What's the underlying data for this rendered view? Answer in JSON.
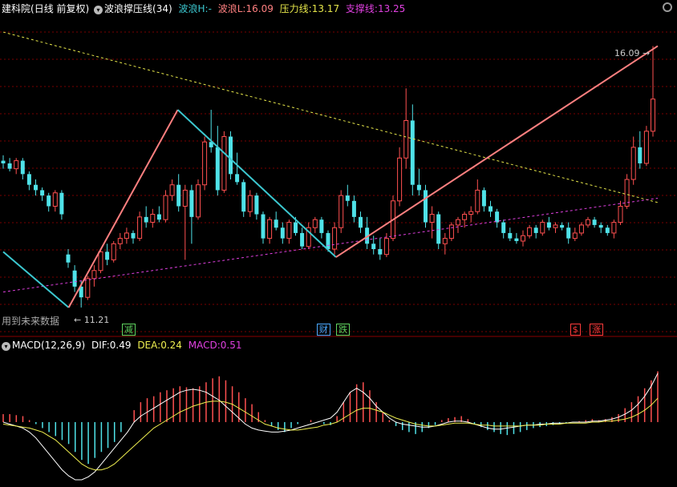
{
  "header": {
    "title": "建科院",
    "period": "(日线 前复权)",
    "indicator_name": "波浪撑压线(34)",
    "wave_h_label": "波浪H:",
    "wave_h_value": "-",
    "wave_l_label": "波浪L:",
    "wave_l_value": "16.09",
    "pressure_label": "压力线:",
    "pressure_value": "13.17",
    "support_label": "支撑线:",
    "support_value": "13.25"
  },
  "macd_header": {
    "name": "MACD(12,26,9)",
    "dif_label": "DIF:",
    "dif_value": "0.49",
    "dea_label": "DEA:",
    "dea_value": "0.24",
    "macd_label": "MACD:",
    "macd_value": "0.51"
  },
  "annotations": {
    "future_data_note": "用到未来数据",
    "low_label": "11.21",
    "high_label": "16.09"
  },
  "event_tags": [
    {
      "text": "减",
      "color": "#5fd35f",
      "index": 19
    },
    {
      "text": "财",
      "color": "#4aa8ff",
      "index": 49
    },
    {
      "text": "跌",
      "color": "#5fd35f",
      "index": 52
    },
    {
      "text": "$",
      "color": "#ff3b3b",
      "index": 88
    },
    {
      "text": "涨",
      "color": "#ff3b3b",
      "index": 91
    }
  ],
  "colors": {
    "up": "#ff5050",
    "down": "#4fe2e8",
    "grid": "#7a0000",
    "wave_up": "#ff8080",
    "wave_down": "#3cc8d0",
    "pressure": "#e6e64a",
    "support": "#e040e0",
    "dif": "#ffffff",
    "dea": "#f0f050"
  },
  "chart_data": [
    {
      "type": "candlestick",
      "title": "",
      "series": [
        {
          "name": "",
          "ohlc": [
            [
              13.95,
              14.05,
              13.8,
              13.9
            ],
            [
              13.9,
              14.0,
              13.75,
              13.8
            ],
            [
              13.8,
              14.0,
              13.7,
              13.95
            ],
            [
              13.95,
              14.0,
              13.6,
              13.7
            ],
            [
              13.7,
              13.75,
              13.4,
              13.5
            ],
            [
              13.5,
              13.6,
              13.3,
              13.4
            ],
            [
              13.4,
              13.45,
              13.2,
              13.3
            ],
            [
              13.3,
              13.35,
              13.0,
              13.1
            ],
            [
              13.1,
              13.4,
              13.0,
              13.35
            ],
            [
              13.35,
              13.4,
              12.85,
              12.95
            ],
            [
              12.2,
              12.3,
              11.95,
              12.05
            ],
            [
              11.9,
              12.0,
              11.5,
              11.6
            ],
            [
              11.6,
              11.7,
              11.21,
              11.4
            ],
            [
              11.4,
              11.8,
              11.35,
              11.75
            ],
            [
              11.75,
              12.0,
              11.6,
              11.9
            ],
            [
              11.9,
              12.3,
              11.85,
              12.25
            ],
            [
              12.25,
              12.4,
              12.0,
              12.1
            ],
            [
              12.1,
              12.45,
              12.05,
              12.4
            ],
            [
              12.4,
              12.6,
              12.3,
              12.5
            ],
            [
              12.5,
              12.7,
              12.4,
              12.6
            ],
            [
              12.6,
              12.65,
              12.4,
              12.5
            ],
            [
              12.5,
              13.0,
              12.45,
              12.9
            ],
            [
              12.9,
              13.1,
              12.7,
              12.8
            ],
            [
              12.8,
              13.05,
              12.7,
              12.95
            ],
            [
              12.95,
              13.1,
              12.8,
              12.85
            ],
            [
              12.85,
              13.4,
              12.8,
              13.3
            ],
            [
              13.3,
              13.6,
              13.2,
              13.5
            ],
            [
              13.5,
              13.7,
              13.0,
              13.1
            ],
            [
              13.1,
              13.5,
              12.1,
              13.4
            ],
            [
              13.4,
              13.5,
              12.4,
              12.9
            ],
            [
              12.9,
              13.6,
              12.85,
              13.5
            ],
            [
              13.5,
              14.4,
              13.4,
              14.3
            ],
            [
              14.3,
              14.9,
              14.1,
              14.2
            ],
            [
              14.2,
              14.6,
              13.3,
              13.4
            ],
            [
              13.4,
              14.5,
              13.35,
              14.4
            ],
            [
              14.4,
              14.5,
              13.6,
              13.7
            ],
            [
              13.7,
              14.1,
              13.5,
              13.55
            ],
            [
              13.55,
              13.6,
              12.9,
              13.0
            ],
            [
              13.0,
              13.4,
              12.9,
              13.3
            ],
            [
              13.3,
              13.35,
              12.85,
              12.95
            ],
            [
              12.95,
              13.0,
              12.4,
              12.5
            ],
            [
              12.5,
              12.9,
              12.4,
              12.85
            ],
            [
              12.85,
              13.0,
              12.65,
              12.7
            ],
            [
              12.7,
              12.8,
              12.4,
              12.5
            ],
            [
              12.5,
              12.85,
              12.4,
              12.8
            ],
            [
              12.8,
              12.9,
              12.55,
              12.6
            ],
            [
              12.6,
              12.7,
              12.3,
              12.35
            ],
            [
              12.35,
              12.8,
              12.3,
              12.7
            ],
            [
              12.7,
              12.9,
              12.6,
              12.85
            ],
            [
              12.85,
              12.9,
              12.5,
              12.6
            ],
            [
              12.6,
              12.65,
              12.25,
              12.3
            ],
            [
              12.3,
              12.8,
              12.2,
              12.7
            ],
            [
              12.7,
              13.4,
              12.6,
              13.3
            ],
            [
              13.3,
              13.5,
              13.1,
              13.2
            ],
            [
              13.2,
              13.3,
              12.8,
              12.9
            ],
            [
              12.9,
              13.0,
              12.6,
              12.7
            ],
            [
              12.7,
              12.9,
              12.3,
              12.4
            ],
            [
              12.4,
              12.55,
              12.2,
              12.3
            ],
            [
              12.3,
              12.5,
              12.1,
              12.2
            ],
            [
              12.2,
              12.6,
              12.15,
              12.5
            ],
            [
              12.5,
              13.3,
              12.45,
              13.2
            ],
            [
              13.2,
              14.2,
              13.1,
              14.0
            ],
            [
              14.0,
              15.3,
              13.8,
              14.7
            ],
            [
              14.7,
              15.0,
              13.3,
              13.5
            ],
            [
              13.5,
              13.8,
              13.3,
              13.4
            ],
            [
              13.4,
              13.5,
              12.7,
              12.8
            ],
            [
              12.8,
              13.1,
              12.5,
              12.95
            ],
            [
              12.95,
              13.0,
              12.3,
              12.4
            ],
            [
              12.4,
              12.6,
              12.2,
              12.5
            ],
            [
              12.5,
              12.8,
              12.45,
              12.75
            ],
            [
              12.75,
              12.9,
              12.6,
              12.85
            ],
            [
              12.85,
              13.0,
              12.7,
              12.95
            ],
            [
              12.95,
              13.1,
              12.8,
              13.0
            ],
            [
              13.0,
              13.6,
              12.95,
              13.4
            ],
            [
              13.4,
              13.45,
              13.0,
              13.1
            ],
            [
              13.1,
              13.2,
              12.9,
              13.0
            ],
            [
              13.0,
              13.05,
              12.7,
              12.8
            ],
            [
              12.8,
              12.85,
              12.5,
              12.6
            ],
            [
              12.6,
              12.7,
              12.45,
              12.5
            ],
            [
              12.5,
              12.6,
              12.4,
              12.45
            ],
            [
              12.45,
              12.65,
              12.35,
              12.55
            ],
            [
              12.55,
              12.75,
              12.5,
              12.7
            ],
            [
              12.7,
              12.75,
              12.5,
              12.6
            ],
            [
              12.6,
              12.85,
              12.55,
              12.8
            ],
            [
              12.8,
              12.9,
              12.65,
              12.7
            ],
            [
              12.7,
              12.8,
              12.6,
              12.75
            ],
            [
              12.75,
              12.8,
              12.65,
              12.7
            ],
            [
              12.7,
              12.8,
              12.4,
              12.5
            ],
            [
              12.5,
              12.7,
              12.45,
              12.6
            ],
            [
              12.6,
              12.8,
              12.55,
              12.75
            ],
            [
              12.75,
              12.9,
              12.7,
              12.85
            ],
            [
              12.85,
              12.9,
              12.7,
              12.75
            ],
            [
              12.75,
              12.8,
              12.6,
              12.7
            ],
            [
              12.7,
              12.75,
              12.55,
              12.6
            ],
            [
              12.6,
              12.85,
              12.5,
              12.8
            ],
            [
              12.8,
              13.2,
              12.75,
              13.1
            ],
            [
              13.1,
              13.7,
              13.05,
              13.6
            ],
            [
              13.6,
              14.4,
              13.5,
              14.2
            ],
            [
              14.2,
              14.5,
              13.8,
              13.9
            ],
            [
              13.9,
              14.6,
              13.85,
              14.5
            ],
            [
              14.5,
              16.09,
              14.4,
              15.1
            ]
          ]
        }
      ],
      "wave_points": [
        {
          "index": 0,
          "price": 12.25
        },
        {
          "index": 12,
          "price": 11.21
        },
        {
          "index": 32,
          "price": 14.9
        },
        {
          "index": 61,
          "price": 12.15
        },
        {
          "index": 120,
          "price": 16.09
        }
      ],
      "pressure_line": {
        "start": [
          0,
          16.35
        ],
        "end": [
          120,
          13.17
        ]
      },
      "support_line": {
        "start": [
          0,
          11.5
        ],
        "end": [
          120,
          13.25
        ]
      },
      "ylim": [
        10.85,
        16.65
      ]
    },
    {
      "type": "bar",
      "title": "",
      "ylim": [
        -0.62,
        0.7
      ],
      "macd_hist": [
        0.08,
        0.08,
        0.07,
        0.06,
        0.02,
        -0.02,
        -0.06,
        -0.1,
        -0.14,
        -0.18,
        -0.22,
        -0.3,
        -0.38,
        -0.42,
        -0.36,
        -0.3,
        -0.26,
        -0.2,
        -0.1,
        0.0,
        0.12,
        0.2,
        0.24,
        0.26,
        0.3,
        0.32,
        0.34,
        0.36,
        0.35,
        0.34,
        0.36,
        0.4,
        0.44,
        0.46,
        0.42,
        0.36,
        0.3,
        0.24,
        0.18,
        0.1,
        0.02,
        -0.04,
        -0.08,
        -0.1,
        -0.06,
        -0.02,
        0.0,
        0.02,
        0.0,
        -0.02,
        -0.03,
        0.06,
        0.2,
        0.3,
        0.38,
        0.4,
        0.32,
        0.2,
        0.1,
        0.02,
        -0.04,
        -0.08,
        -0.1,
        -0.12,
        -0.1,
        -0.06,
        -0.03,
        0.02,
        0.04,
        0.05,
        0.06,
        0.03,
        -0.02,
        -0.05,
        -0.08,
        -0.1,
        -0.12,
        -0.13,
        -0.12,
        -0.1,
        -0.08,
        -0.06,
        -0.05,
        -0.04,
        -0.03,
        -0.02,
        -0.01,
        0.0,
        0.01,
        0.02,
        0.03,
        0.02,
        0.03,
        0.05,
        0.08,
        0.14,
        0.2,
        0.26,
        0.34,
        0.42,
        0.51
      ],
      "dif": [
        0.0,
        -0.02,
        -0.04,
        -0.06,
        -0.1,
        -0.16,
        -0.24,
        -0.32,
        -0.4,
        -0.48,
        -0.54,
        -0.58,
        -0.58,
        -0.55,
        -0.5,
        -0.42,
        -0.34,
        -0.26,
        -0.18,
        -0.1,
        0.0,
        0.06,
        0.1,
        0.14,
        0.18,
        0.22,
        0.26,
        0.3,
        0.32,
        0.33,
        0.32,
        0.3,
        0.26,
        0.22,
        0.16,
        0.1,
        0.04,
        -0.02,
        -0.06,
        -0.08,
        -0.09,
        -0.1,
        -0.1,
        -0.09,
        -0.08,
        -0.06,
        -0.04,
        -0.02,
        0.0,
        0.02,
        0.04,
        0.1,
        0.2,
        0.3,
        0.34,
        0.3,
        0.24,
        0.16,
        0.1,
        0.04,
        0.0,
        -0.02,
        -0.03,
        -0.04,
        -0.05,
        -0.05,
        -0.04,
        -0.02,
        0.0,
        0.01,
        0.01,
        0.0,
        -0.02,
        -0.04,
        -0.06,
        -0.07,
        -0.07,
        -0.06,
        -0.05,
        -0.04,
        -0.03,
        -0.03,
        -0.02,
        -0.02,
        -0.01,
        -0.01,
        -0.01,
        0.0,
        0.0,
        0.0,
        0.01,
        0.01,
        0.02,
        0.03,
        0.05,
        0.08,
        0.12,
        0.18,
        0.26,
        0.36,
        0.49
      ],
      "dea": [
        -0.02,
        -0.03,
        -0.04,
        -0.05,
        -0.06,
        -0.08,
        -0.1,
        -0.14,
        -0.18,
        -0.24,
        -0.3,
        -0.36,
        -0.42,
        -0.46,
        -0.48,
        -0.48,
        -0.46,
        -0.42,
        -0.36,
        -0.3,
        -0.24,
        -0.18,
        -0.12,
        -0.06,
        -0.02,
        0.02,
        0.06,
        0.1,
        0.13,
        0.16,
        0.18,
        0.2,
        0.21,
        0.21,
        0.2,
        0.18,
        0.14,
        0.1,
        0.06,
        0.02,
        -0.02,
        -0.04,
        -0.06,
        -0.07,
        -0.08,
        -0.08,
        -0.07,
        -0.06,
        -0.05,
        -0.03,
        -0.02,
        0.0,
        0.04,
        0.08,
        0.12,
        0.14,
        0.14,
        0.12,
        0.1,
        0.07,
        0.04,
        0.02,
        0.0,
        -0.02,
        -0.03,
        -0.04,
        -0.04,
        -0.03,
        -0.02,
        -0.01,
        -0.01,
        -0.01,
        -0.02,
        -0.03,
        -0.03,
        -0.04,
        -0.04,
        -0.04,
        -0.04,
        -0.04,
        -0.03,
        -0.03,
        -0.03,
        -0.02,
        -0.02,
        -0.02,
        -0.01,
        -0.01,
        -0.01,
        -0.01,
        0.0,
        0.0,
        0.01,
        0.01,
        0.02,
        0.03,
        0.05,
        0.08,
        0.12,
        0.17,
        0.24
      ]
    }
  ]
}
